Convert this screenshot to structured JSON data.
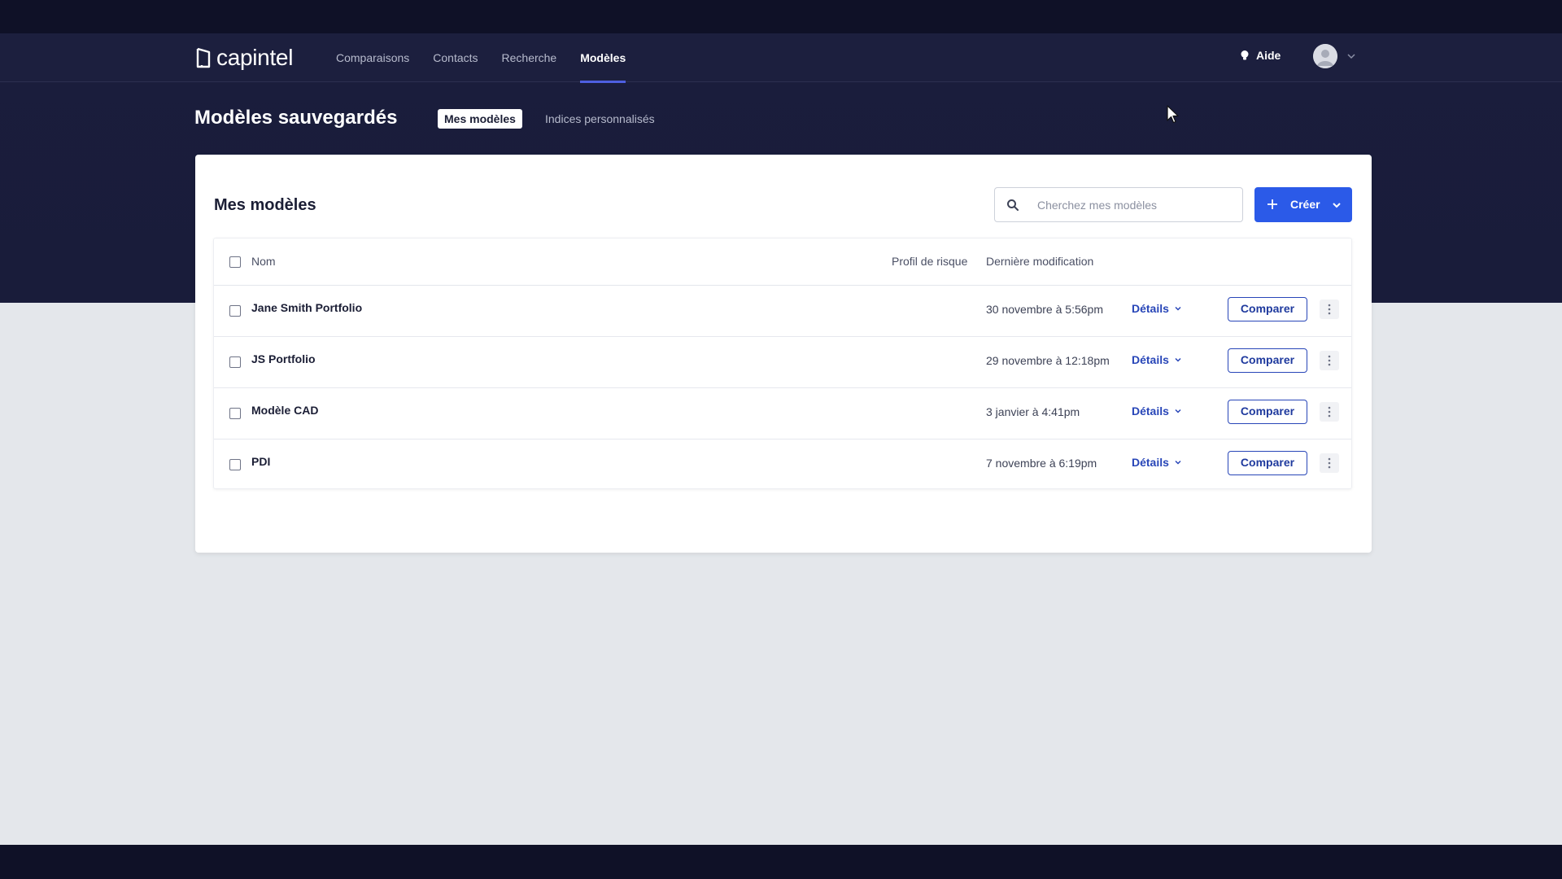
{
  "nav": {
    "logo_text": "capintel",
    "links": [
      {
        "label": "Comparaisons",
        "active": false
      },
      {
        "label": "Contacts",
        "active": false
      },
      {
        "label": "Recherche",
        "active": false
      },
      {
        "label": "Modèles",
        "active": true
      }
    ],
    "help_label": "Aide",
    "help_icon": "lightbulb-icon",
    "avatar_icon": "user-avatar-icon",
    "menu_icon": "chevron-down-icon"
  },
  "page": {
    "title": "Modèles sauvegardés",
    "tabs": [
      {
        "label": "Mes modèles",
        "active": true
      },
      {
        "label": "Indices personnalisés",
        "active": false
      }
    ]
  },
  "card": {
    "title": "Mes modèles",
    "search": {
      "placeholder": "Cherchez mes modèles",
      "value": "",
      "icon": "search-icon"
    },
    "create_button": {
      "label": "Créer",
      "icon": "plus-icon",
      "menu_icon": "chevron-down-icon"
    }
  },
  "table": {
    "columns": {
      "name": "Nom",
      "risk": "Profil de risque",
      "modified": "Dernière modification"
    },
    "rows": [
      {
        "name": "Jane Smith Portfolio",
        "risk": "",
        "modified": "30 novembre à 5:56pm",
        "details": "Détails",
        "compare": "Comparer"
      },
      {
        "name": "JS Portfolio",
        "risk": "",
        "modified": "29 novembre à 12:18pm",
        "details": "Détails",
        "compare": "Comparer"
      },
      {
        "name": "Modèle CAD",
        "risk": "",
        "modified": "3 janvier à 4:41pm",
        "details": "Détails",
        "compare": "Comparer"
      },
      {
        "name": "PDI",
        "risk": "",
        "modified": "7 novembre à 6:19pm",
        "details": "Détails",
        "compare": "Comparer"
      }
    ]
  },
  "colors": {
    "nav_bg": "#1c1f3e",
    "hero_bg": "#1a1d3c",
    "primary": "#2b5ae8",
    "link": "#2846b8",
    "page_bg": "#e4e7eb"
  }
}
